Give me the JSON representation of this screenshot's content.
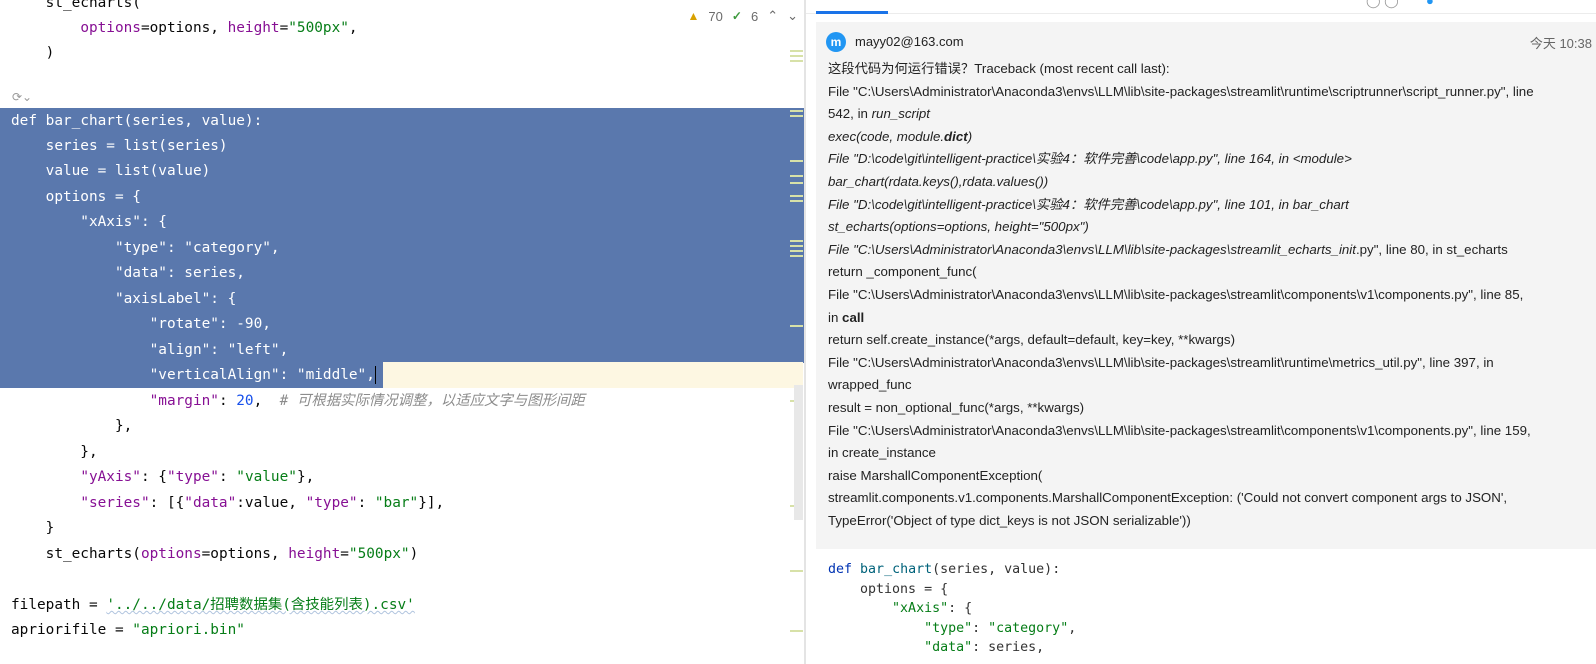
{
  "editor": {
    "inspection": {
      "warnings": "70",
      "typos": "6"
    },
    "lines": [
      "    st_echarts(",
      "        options=options, height=\"500px\",",
      "    )",
      "",
      "",
      "def bar_chart(series, value):",
      "    series = list(series)",
      "    value = list(value)",
      "    options = {",
      "        \"xAxis\": {",
      "            \"type\": \"category\",",
      "            \"data\": series,",
      "            \"axisLabel\": {",
      "                \"rotate\": -90,",
      "                \"align\": \"left\",",
      "                \"verticalAlign\": \"middle\",",
      "                \"margin\": 20,  # 可根据实际情况调整，以适应文字与图形间距",
      "            },",
      "        },",
      "        \"yAxis\": {\"type\": \"value\"},",
      "        \"series\": [{\"data\":value, \"type\": \"bar\"}],",
      "    }",
      "    st_echarts(options=options, height=\"500px\")",
      "",
      "filepath = '../../data/招聘数据集(含技能列表).csv'",
      "apriorifile = \"apriori.bin\""
    ]
  },
  "chat": {
    "sender": "mayy02@163.com",
    "avatar_letter": "m",
    "time": "今天 10:38",
    "message": {
      "intro": "这段代码为何运行错误？Traceback (most recent call last):",
      "l1": "File \"C:\\Users\\Administrator\\Anaconda3\\envs\\LLM\\lib\\site-packages\\streamlit\\runtime\\scriptrunner\\script_runner.py\", line",
      "l2a": "542, in ",
      "l2b": "run_script",
      "l3a": "exec(code, module.",
      "l3b": "dict",
      "l3c": ")",
      "l4": "File \"D:\\code\\git\\intelligent-practice\\实验4：软件完善\\code\\app.py\", line 164, in <module>",
      "l5": "bar_chart(rdata.keys(),rdata.values())",
      "l6": "File \"D:\\code\\git\\intelligent-practice\\实验4：软件完善\\code\\app.py\", line 101, in bar_chart",
      "l7": "st_echarts(options=options, height=\"500px\")",
      "l8a": "File \"C:\\Users\\Administrator\\Anaconda3\\envs\\LLM\\lib\\site-packages\\streamlit_echarts_init",
      "l8b": ".py\", line 80, in st_echarts",
      "l9": "return _component_func(",
      "l10": "File \"C:\\Users\\Administrator\\Anaconda3\\envs\\LLM\\lib\\site-packages\\streamlit\\components\\v1\\components.py\", line 85,",
      "l11a": "in ",
      "l11b": "call",
      "l12": "return self.create_instance(*args, default=default, key=key, **kwargs)",
      "l13": "File \"C:\\Users\\Administrator\\Anaconda3\\envs\\LLM\\lib\\site-packages\\streamlit\\runtime\\metrics_util.py\", line 397, in",
      "l14": "wrapped_func",
      "l15": "result = non_optional_func(*args, **kwargs)",
      "l16": "File \"C:\\Users\\Administrator\\Anaconda3\\envs\\LLM\\lib\\site-packages\\streamlit\\components\\v1\\components.py\", line 159,",
      "l17": "in create_instance",
      "l18": "raise MarshallComponentException(",
      "l19": "streamlit.components.v1.components.MarshallComponentException: ('Could not convert component args to JSON',",
      "l20": "TypeError('Object of type dict_keys is not JSON serializable'))"
    },
    "code_block": [
      "def bar_chart(series, value):",
      "    options = {",
      "        \"xAxis\": {",
      "            \"type\": \"category\",",
      "            \"data\": series,"
    ]
  }
}
